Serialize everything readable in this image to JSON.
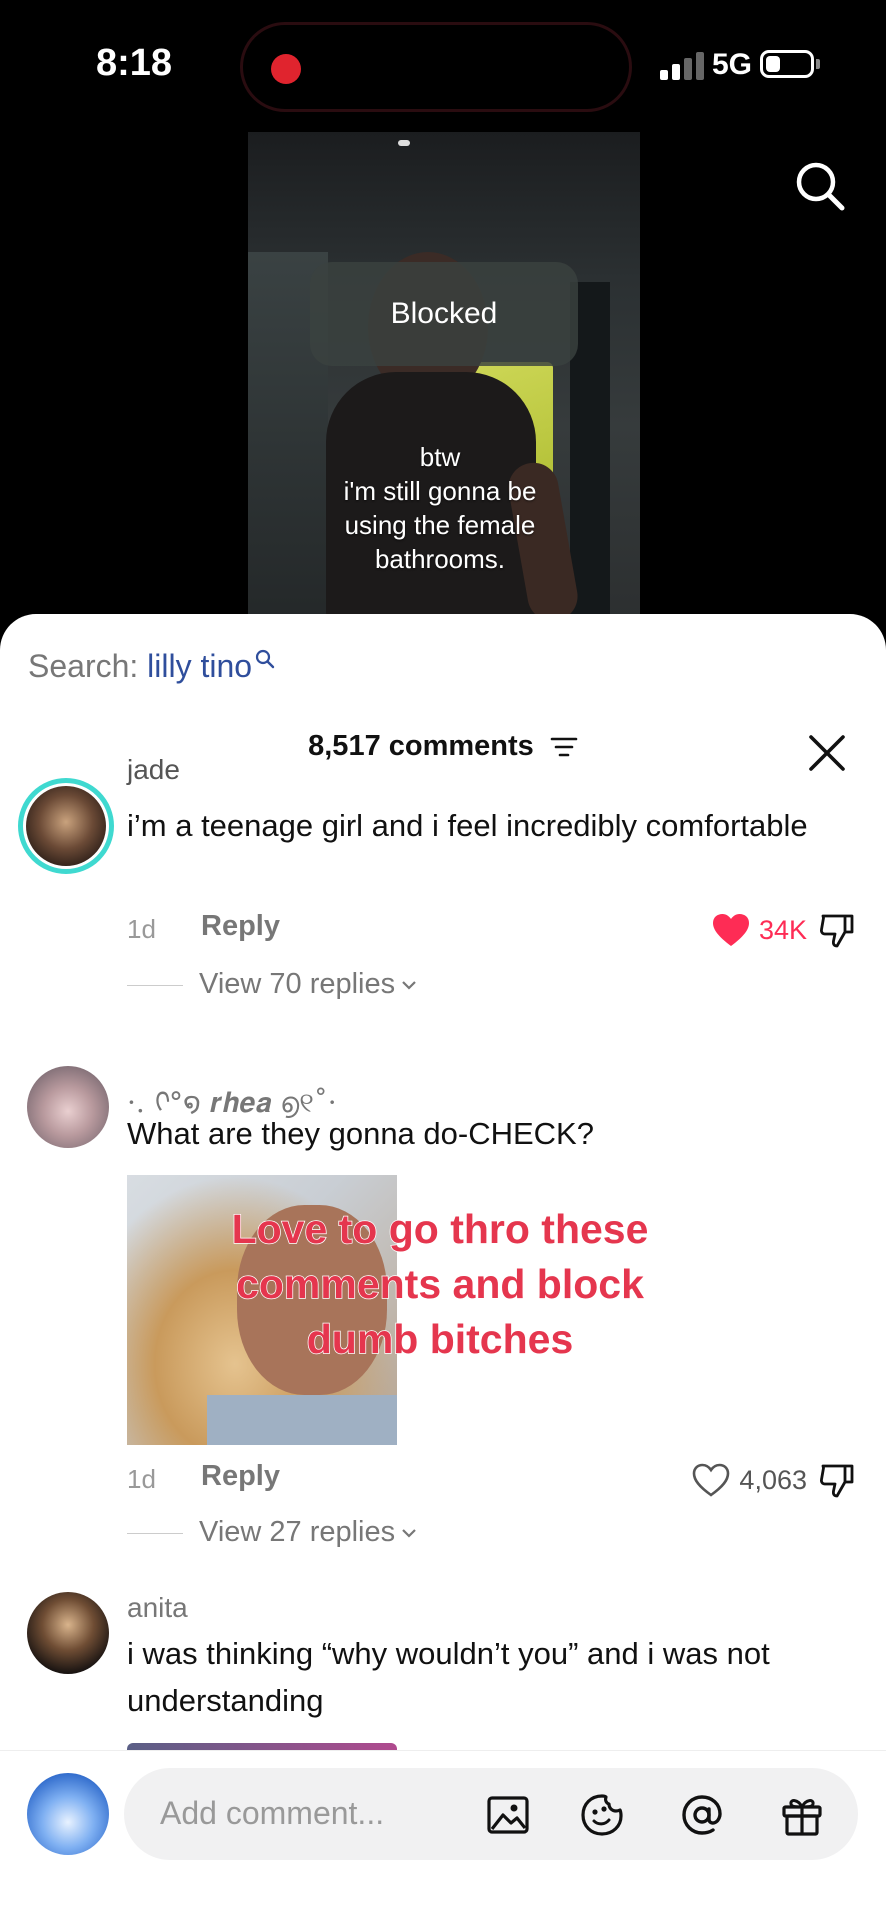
{
  "status_bar": {
    "time": "8:18",
    "network": "5G"
  },
  "video": {
    "overlay_label": "Blocked",
    "caption_lines": [
      "btw",
      "i'm still gonna be",
      "using the female",
      "bathrooms."
    ]
  },
  "sheet": {
    "search_prefix": "Search: ",
    "search_query": "lilly tino",
    "comments_count": "8,517 comments"
  },
  "comments": [
    {
      "username": "jade",
      "text": "i’m a teenage girl and i feel incredibly comfortable",
      "date": "1d",
      "reply": "Reply",
      "likes": "34K",
      "liked": true,
      "view_replies": "View 70 replies"
    },
    {
      "username": "·. ᢉ°໑ 𝒓𝒉𝒆𝒂 ൭୧˚·",
      "text": "What are they gonna do-CHECK?",
      "sticker_lines": [
        "Love to go thro these",
        "comments and block",
        "dumb bitches"
      ],
      "date": "1d",
      "reply": "Reply",
      "likes": "4,063",
      "liked": false,
      "view_replies": "View 27 replies"
    },
    {
      "username": "anita",
      "text": "i was thinking “why wouldn’t you” and i was not understanding"
    }
  ],
  "input": {
    "placeholder": "Add comment..."
  },
  "colors": {
    "like_red": "#fe2c55",
    "search_blue": "#2f4e9c",
    "sticker_text": "#e5364e"
  }
}
